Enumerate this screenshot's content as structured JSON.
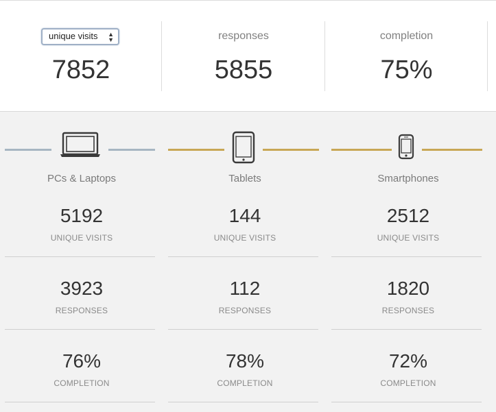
{
  "summary": {
    "metric_select": {
      "value": "unique visits"
    },
    "cells": [
      {
        "label": "unique visits",
        "value": "7852"
      },
      {
        "label": "responses",
        "value": "5855"
      },
      {
        "label": "completion",
        "value": "75%"
      }
    ]
  },
  "devices": [
    {
      "name": "PCs & Laptops",
      "icon": "laptop-icon",
      "color": "#a7b6c2",
      "unique_visits": "5192",
      "responses": "3923",
      "completion": "76%"
    },
    {
      "name": "Tablets",
      "icon": "tablet-icon",
      "color": "#c8a755",
      "unique_visits": "144",
      "responses": "112",
      "completion": "78%"
    },
    {
      "name": "Smartphones",
      "icon": "smartphone-icon",
      "color": "#c8a755",
      "unique_visits": "2512",
      "responses": "1820",
      "completion": "72%"
    }
  ],
  "stat_labels": {
    "unique_visits": "UNIQUE VISITS",
    "responses": "RESPONSES",
    "completion": "COMPLETION"
  }
}
